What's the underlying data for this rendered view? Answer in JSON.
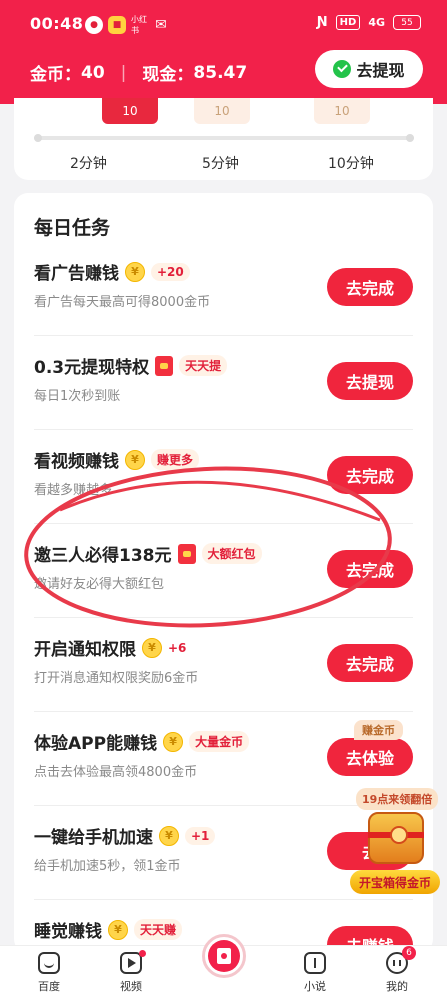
{
  "status_bar": {
    "time": "00:48",
    "signal": "4G",
    "hd": "HD",
    "battery": "55",
    "app_mini": "小红书"
  },
  "header": {
    "coins_label": "金币：",
    "coins_value": "40",
    "cash_label": "现金：",
    "cash_value": "85.47",
    "withdraw_label": "去提现"
  },
  "timer": {
    "boxes": [
      "10",
      "10",
      "10"
    ],
    "labels": [
      "2分钟",
      "5分钟",
      "10分钟"
    ]
  },
  "tasks_section": {
    "title": "每日任务",
    "tasks": [
      {
        "title": "看广告赚钱",
        "icon": "coin-icon",
        "tag": "+20",
        "subtitle": "看广告每天最高可得8000金币",
        "button": "去完成"
      },
      {
        "title": "0.3元提现特权",
        "icon": "red-packet-icon",
        "tag": "天天提",
        "subtitle": "每日1次秒到账",
        "button": "去提现"
      },
      {
        "title": "看视频赚钱",
        "icon": "coin-icon",
        "tag": "赚更多",
        "subtitle": "看越多赚越多",
        "button": "去完成"
      },
      {
        "title": "邀三人必得138元",
        "icon": "red-packet-icon",
        "tag": "大额红包",
        "subtitle": "邀请好友必得大额红包",
        "button": "去完成"
      },
      {
        "title": "开启通知权限",
        "icon": "coin-icon",
        "tag": "+6",
        "subtitle": "打开消息通知权限奖励6金币",
        "button": "去完成"
      },
      {
        "title": "体验APP能赚钱",
        "icon": "coin-icon",
        "tag": "大量金币",
        "subtitle": "点击去体验最高领4800金币",
        "button": "去体验",
        "badge": "赚金币"
      },
      {
        "title": "一键给手机加速",
        "icon": "coin-icon",
        "tag": "+1",
        "subtitle": "给手机加速5秒，领1金币",
        "button": "去"
      },
      {
        "title": "睡觉赚钱",
        "icon": "coin-icon",
        "tag": "天天赚",
        "subtitle": "",
        "button": "去赚钱"
      }
    ]
  },
  "treasure": {
    "top_label": "19点来领翻倍",
    "bottom_label": "开宝箱得金币"
  },
  "bottom_nav": {
    "items": [
      "百度",
      "视频",
      "",
      "小说",
      "我的"
    ],
    "me_badge": "6"
  },
  "colors": {
    "brand_red": "#f2214a",
    "button_red": "#f0253d",
    "coin_gold": "#ffd54a"
  }
}
